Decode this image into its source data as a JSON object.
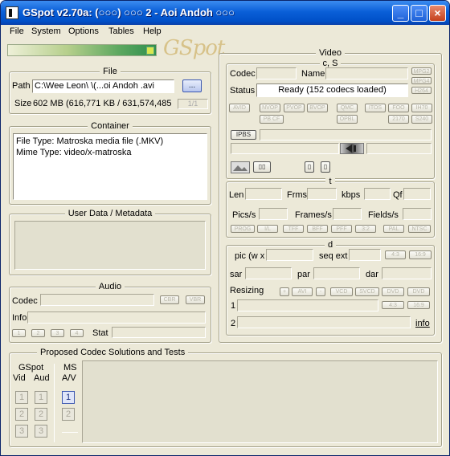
{
  "window": {
    "title": "GSpot v2.70a: (○○○) ○○○ 2 - Aoi Andoh ○○○",
    "minimize": "_",
    "maximize": "□",
    "close": "×"
  },
  "menu": [
    "File",
    "System",
    "Options",
    "Tables",
    "Help"
  ],
  "logo": "GSpot",
  "file": {
    "legend": "File",
    "path_label": "Path",
    "path_value": "C:\\Wee Leon\\    \\(...oi Andoh    .avi",
    "browse": "...",
    "size_label": "Size",
    "size_value": "602 MB (616,771 KB / 631,574,485",
    "page": "1/1"
  },
  "container": {
    "legend": "Container",
    "line1": "File Type: Matroska media file (.MKV)",
    "line2": "Mime Type: video/x-matroska"
  },
  "userdata": {
    "legend": "User Data / Metadata"
  },
  "audio": {
    "legend": "Audio",
    "codec_label": "Codec",
    "cbr": "CBR",
    "vbr": "VBR",
    "info_label": "Info",
    "stat_label": "Stat",
    "small": [
      "1",
      "2",
      "3",
      "4"
    ]
  },
  "video": {
    "legend": "Video",
    "sub1": "c, S",
    "codec_label": "Codec",
    "name_label": "Name",
    "status_label": "Status",
    "status_value": "Ready (152 codecs loaded)",
    "right_tags": [
      "MPG2",
      "MPG4",
      "H264"
    ],
    "row_a": [
      "AVID",
      "NVOP",
      "PVOP",
      "BVOP",
      "QMC",
      "ITOS",
      "FOO",
      "IH70"
    ],
    "row_b": [
      "PB CF",
      "OPBL",
      "2170",
      "S240"
    ],
    "ipbs": "IPBS",
    "sub2": "t",
    "len": "Len",
    "frms": "Frms",
    "kbps": "kbps",
    "qf": "Qf",
    "pics": "Pics/s",
    "frames": "Frames/s",
    "fields": "Fields/s",
    "row_c": [
      "PROG",
      "I/L",
      "TFF",
      "BFF",
      "PFF",
      "3:2",
      "PAL",
      "NTSC"
    ],
    "sub3": "d",
    "pic": "pic (w x",
    "seqext": "seq ext",
    "r43": "4:3",
    "r169": "16:9",
    "sar": "sar",
    "par": "par",
    "dar": "dar",
    "resizing": "Resizing",
    "plus": "+",
    "avi": "AVI",
    "minus": "-",
    "vcd": "VCD",
    "svcd": "SVCD",
    "dvd": "DVD",
    "dvd2": "DVD",
    "r43b": "4:3",
    "r169b": "16:9",
    "one": "1",
    "two": "2",
    "info_link": "info"
  },
  "proposed": {
    "legend": "Proposed Codec Solutions and Tests",
    "gspot": "GSpot",
    "vid": "Vid",
    "aud": "Aud",
    "ms": "MS",
    "av": "A/V",
    "nums": [
      "1",
      "2",
      "3"
    ]
  }
}
